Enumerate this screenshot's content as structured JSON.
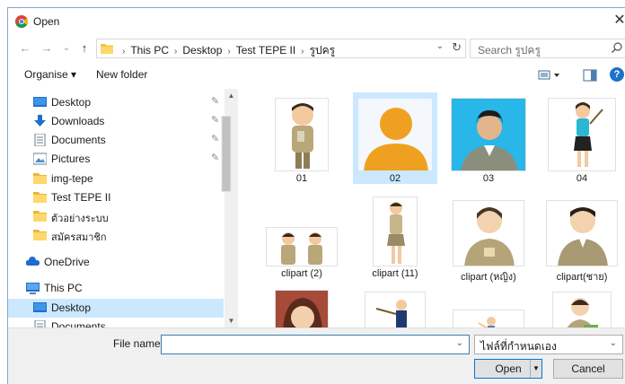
{
  "window": {
    "title": "Open",
    "close_glyph": "✕"
  },
  "nav": {
    "back_glyph": "←",
    "forward_glyph": "→",
    "recent_glyph": "⌄",
    "up_glyph": "↑",
    "breadcrumbs": [
      "This PC",
      "Desktop",
      "Test TEPE II",
      "รูปครู"
    ],
    "search_placeholder": "Search รูปครู"
  },
  "toolbar": {
    "organise": "Organise ▾",
    "new_folder": "New folder",
    "help": "?"
  },
  "sidebar": {
    "items": [
      {
        "label": "Desktop",
        "icon": "desktop-icon",
        "pinned": true
      },
      {
        "label": "Downloads",
        "icon": "download-icon",
        "pinned": true
      },
      {
        "label": "Documents",
        "icon": "document-icon",
        "pinned": true
      },
      {
        "label": "Pictures",
        "icon": "pictures-icon",
        "pinned": true
      },
      {
        "label": "img-tepe",
        "icon": "folder-icon",
        "pinned": false
      },
      {
        "label": "Test TEPE II",
        "icon": "folder-icon",
        "pinned": false
      },
      {
        "label": "ตัวอย่างระบบ",
        "icon": "folder-icon",
        "pinned": false
      },
      {
        "label": "สมัครสมาชิก",
        "icon": "folder-icon",
        "pinned": false
      },
      {
        "label": "OneDrive",
        "icon": "cloud-icon",
        "pinned": false
      },
      {
        "label": "This PC",
        "icon": "computer-icon",
        "pinned": false
      },
      {
        "label": "Desktop",
        "icon": "desktop-icon",
        "pinned": false,
        "selected": true
      },
      {
        "label": "Documents",
        "icon": "document-icon",
        "pinned": false
      }
    ],
    "pin_glyph": "📌"
  },
  "files": {
    "items": [
      {
        "name": "01",
        "kind": "teacher-man-cartoon"
      },
      {
        "name": "02",
        "kind": "person-silhouette",
        "selected": true
      },
      {
        "name": "03",
        "kind": "man-photo-portrait"
      },
      {
        "name": "04",
        "kind": "teacher-woman-pointer"
      },
      {
        "name": "clipart (2)",
        "kind": "two-teachers"
      },
      {
        "name": "clipart (11)",
        "kind": "woman-standing"
      },
      {
        "name": "clipart (หญิง)",
        "kind": "woman-teacher-headset"
      },
      {
        "name": "clipart(ชาย)",
        "kind": "man-teacher-headset"
      },
      {
        "name": "",
        "kind": "woman-photo"
      },
      {
        "name": "",
        "kind": "man-pointing-board"
      },
      {
        "name": "",
        "kind": "man-presenting"
      },
      {
        "name": "",
        "kind": "woman-reading"
      }
    ]
  },
  "bottom": {
    "file_name_label": "File name:",
    "file_name_value": "",
    "filter_value": "ไฟล์ที่กำหนดเอง",
    "open_label": "Open",
    "cancel_label": "Cancel"
  },
  "colors": {
    "accent": "#0078d7",
    "selection": "#cce8ff",
    "folder": "#f2c53d"
  }
}
